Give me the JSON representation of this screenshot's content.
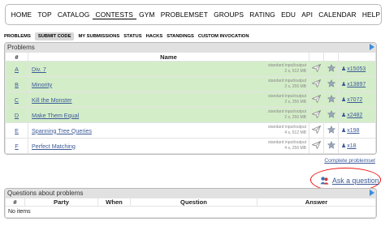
{
  "nav": [
    "HOME",
    "TOP",
    "CATALOG",
    "CONTESTS",
    "GYM",
    "PROBLEMSET",
    "GROUPS",
    "RATING",
    "EDU",
    "API",
    "CALENDAR",
    "HELP"
  ],
  "nav_active": "CONTESTS",
  "subnav": [
    "PROBLEMS",
    "SUBMIT CODE",
    "MY SUBMISSIONS",
    "STATUS",
    "HACKS",
    "STANDINGS",
    "CUSTOM INVOCATION"
  ],
  "subnav_selected": "SUBMIT CODE",
  "problems": {
    "title": "Problems",
    "col_name": "Name",
    "rows": [
      {
        "id": "A",
        "name": "Div. 7",
        "io": "standard input/output",
        "limits": "2 s, 512 MB",
        "solved": "x15053",
        "accepted": true
      },
      {
        "id": "B",
        "name": "Minority",
        "io": "standard input/output",
        "limits": "2 s, 256 MB",
        "solved": "x13897",
        "accepted": true
      },
      {
        "id": "C",
        "name": "Kill the Monster",
        "io": "standard input/output",
        "limits": "2 s, 256 MB",
        "solved": "x7072",
        "accepted": true
      },
      {
        "id": "D",
        "name": "Make Them Equal",
        "io": "standard input/output",
        "limits": "2 s, 256 MB",
        "solved": "x2482",
        "accepted": true
      },
      {
        "id": "E",
        "name": "Spanning Tree Queries",
        "io": "standard input/output",
        "limits": "4 s, 512 MB",
        "solved": "x198",
        "accepted": false
      },
      {
        "id": "F",
        "name": "Perfect Matching",
        "io": "standard input/output",
        "limits": "4 s, 256 MB",
        "solved": "x18",
        "accepted": false
      }
    ],
    "complete_link": "Complete problemset"
  },
  "ask_question": "Ask a question",
  "questions": {
    "title": "Questions about problems",
    "columns": [
      "#",
      "Party",
      "When",
      "Question",
      "Answer"
    ],
    "empty": "No items"
  },
  "colors": {
    "accent": "#3b5998",
    "accepted_bg": "#d4edc9",
    "header_bg": "#e1e1e1",
    "highlight_ring": "#e11111",
    "arrow": "#3b8cdc"
  }
}
